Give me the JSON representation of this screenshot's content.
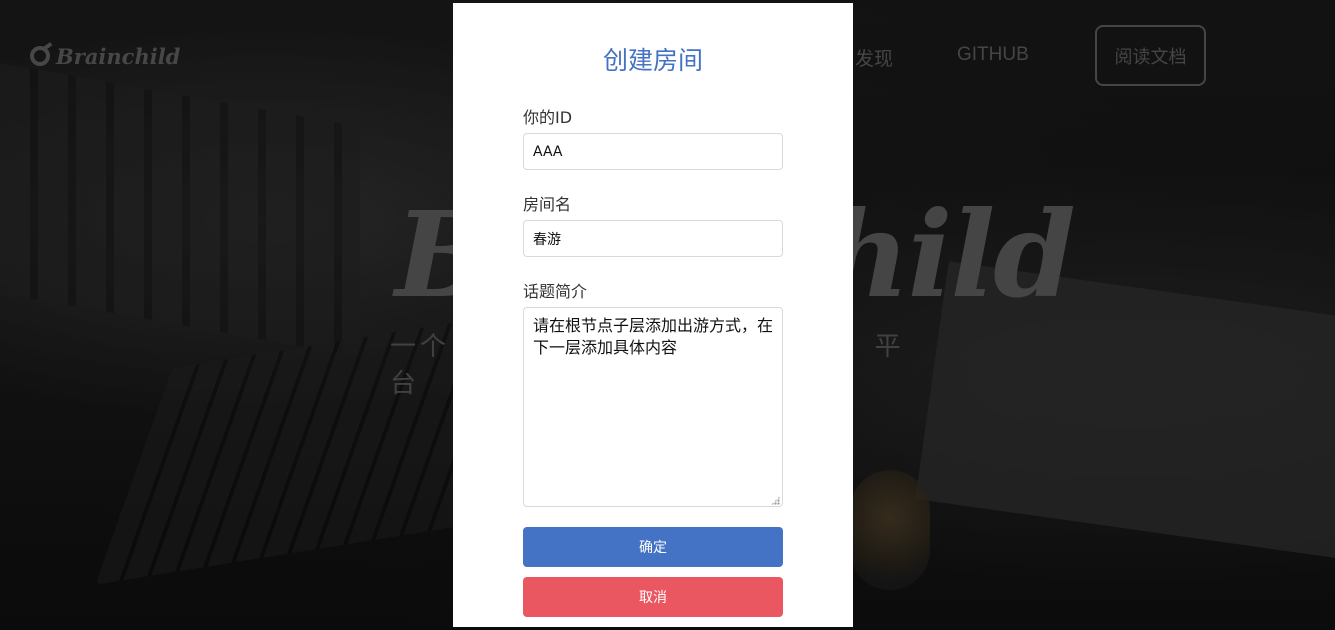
{
  "nav": {
    "logo_text": "Brainchild",
    "discover_label": "发现",
    "github_label": "GITHUB",
    "docs_label": "阅读文档"
  },
  "hero": {
    "title": "Brainchild",
    "subtitle_fragment_left": "一个",
    "subtitle_fragment_right": "平台"
  },
  "modal": {
    "title": "创建房间",
    "id_label": "你的ID",
    "id_value": "AAA",
    "room_label": "房间名",
    "room_value": "春游",
    "topic_label": "话题简介",
    "topic_value": "请在根节点子层添加出游方式，在下一层添加具体内容",
    "confirm_label": "确定",
    "cancel_label": "取消"
  },
  "colors": {
    "accent": "#4472c4",
    "danger": "#eb5760"
  }
}
